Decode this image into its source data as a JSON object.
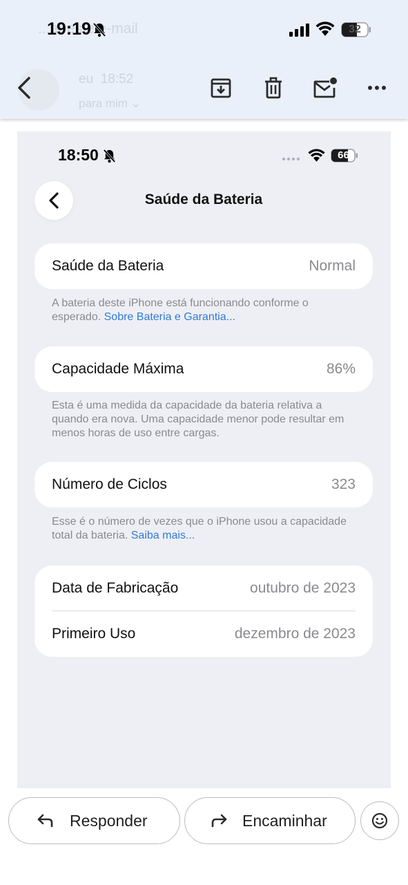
{
  "status_bar": {
    "time": "19:19",
    "battery": "32"
  },
  "email_header": {
    "subject_ghost": "...ar este e-mail",
    "sender_ghost": "eu",
    "time_ghost": "18:52",
    "to_ghost": "para mim"
  },
  "embedded": {
    "status_bar": {
      "time": "18:50",
      "battery": "66"
    },
    "title": "Saúde da Bateria",
    "health": {
      "label": "Saúde da Bateria",
      "value": "Normal"
    },
    "health_note": "A bateria deste iPhone está funcionando conforme o esperado.",
    "health_link": "Sobre Bateria e Garantia...",
    "capacity": {
      "label": "Capacidade Máxima",
      "value": "86%"
    },
    "capacity_note": "Esta é uma medida da capacidade da bateria relativa a quando era nova. Uma capacidade menor pode resultar em menos horas de uso entre cargas.",
    "cycles": {
      "label": "Número de Ciclos",
      "value": "323"
    },
    "cycles_note": "Esse é o número de vezes que o iPhone usou a capacidade total da bateria.",
    "cycles_link": "Saiba mais...",
    "manufacture": {
      "label": "Data de Fabricação",
      "value": "outubro de 2023"
    },
    "first_use": {
      "label": "Primeiro Uso",
      "value": "dezembro de 2023"
    }
  },
  "actions": {
    "reply": "Responder",
    "forward": "Encaminhar"
  },
  "icons": {
    "back": "back-arrow-icon",
    "archive": "archive-icon",
    "delete": "trash-icon",
    "mark_unread": "mail-unread-icon",
    "more": "more-horizontal-icon",
    "reply": "reply-icon",
    "forward": "forward-icon",
    "emoji": "emoji-icon"
  },
  "colors": {
    "header_bg": "#eaf0fa",
    "link": "#2f7bd6",
    "inner_bg": "#eeeff4"
  }
}
